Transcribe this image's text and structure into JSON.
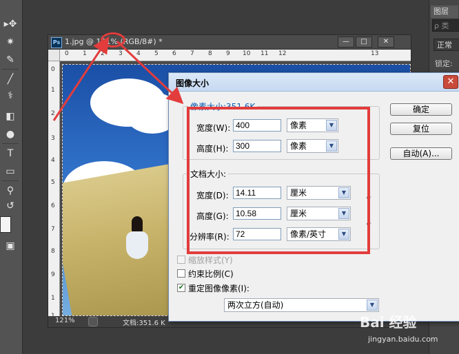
{
  "document": {
    "title": "1.jpg @ 121% (RGB/8#) *",
    "ps_icon": "Ps",
    "ruler_top": [
      "0",
      "1",
      "2",
      "3",
      "4",
      "5",
      "6",
      "7",
      "8",
      "9",
      "10",
      "11",
      "12",
      "13"
    ],
    "ruler_left": [
      "0",
      "1",
      "2",
      "3",
      "4",
      "5",
      "6",
      "7",
      "8",
      "9",
      "1",
      "1"
    ],
    "status": {
      "zoom": "121%",
      "doc_size": "文档:351.6 K"
    },
    "window_buttons": {
      "minimize": "—",
      "maximize": "□",
      "close": "✕"
    }
  },
  "right_panel": {
    "tab": "图层",
    "search": "ρ 类",
    "mode": "正常",
    "lock": "锁定:"
  },
  "toolbox": {
    "icons": [
      "move-icon",
      "magic-wand-icon",
      "eyedropper-icon",
      "brush-icon",
      "clone-stamp-icon",
      "eraser-icon",
      "gradient-icon",
      "dodge-icon",
      "pen-icon",
      "type-icon",
      "shape-icon",
      "zoom-icon",
      "swap-colors-icon",
      "screen-mode-icon"
    ],
    "glyphs": [
      "▸✥",
      "✷",
      "✎",
      "╱",
      "⚕",
      "▭",
      "◧",
      "●",
      "✒",
      "T",
      "▭",
      "⚲",
      "↺",
      "▣"
    ]
  },
  "dialog": {
    "title": "图像大小",
    "close": "✕",
    "pixel_dimensions": {
      "legend": "像素大小:351.6K",
      "width_label": "宽度(W):",
      "width_value": "400",
      "width_unit": "像素",
      "height_label": "高度(H):",
      "height_value": "300",
      "height_unit": "像素"
    },
    "document_size": {
      "legend": "文档大小:",
      "width_label": "宽度(D):",
      "width_value": "14.11",
      "width_unit": "厘米",
      "height_label": "高度(G):",
      "height_value": "10.58",
      "height_unit": "厘米",
      "resolution_label": "分辨率(R):",
      "resolution_value": "72",
      "resolution_unit": "像素/英寸"
    },
    "buttons": {
      "ok": "确定",
      "reset": "复位",
      "auto": "自动(A)..."
    },
    "options": {
      "scale_styles": "缩放样式(Y)",
      "constrain": "约束比例(C)",
      "resample": "重定图像像素(I):",
      "resample_method": "两次立方(自动)",
      "resample_checked": true,
      "constrain_checked": false
    }
  },
  "watermark": {
    "text": "Bai 经验",
    "url": "jingyan.baidu.com"
  },
  "annotation_color": "#e23c3c"
}
